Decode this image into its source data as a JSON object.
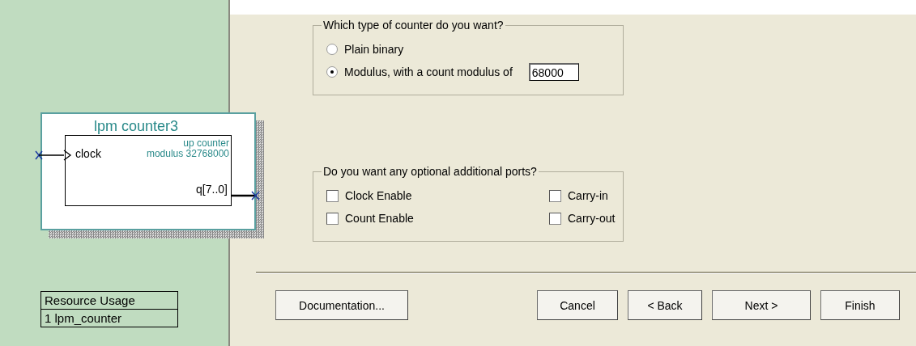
{
  "symbol": {
    "title": "lpm counter3",
    "input": "clock",
    "notes": [
      "up counter",
      "modulus 32768000"
    ],
    "output": "q[7..0]"
  },
  "resource_usage": {
    "header": "Resource Usage",
    "rows": [
      "1 lpm_counter"
    ]
  },
  "counter_type": {
    "legend": "Which type of counter do you want?",
    "options": [
      {
        "label": "Plain binary",
        "selected": false
      },
      {
        "label": "Modulus, with a count modulus of",
        "selected": true
      }
    ],
    "modulus_value": "68000"
  },
  "ports": {
    "legend": "Do you want any optional additional ports?",
    "options": [
      {
        "label": "Clock Enable",
        "checked": false
      },
      {
        "label": "Carry-in",
        "checked": false
      },
      {
        "label": "Count Enable",
        "checked": false
      },
      {
        "label": "Carry-out",
        "checked": false
      }
    ]
  },
  "help_button": "Documentation...",
  "buttons": [
    "Cancel",
    "< Back",
    "Next >",
    "Finish"
  ]
}
